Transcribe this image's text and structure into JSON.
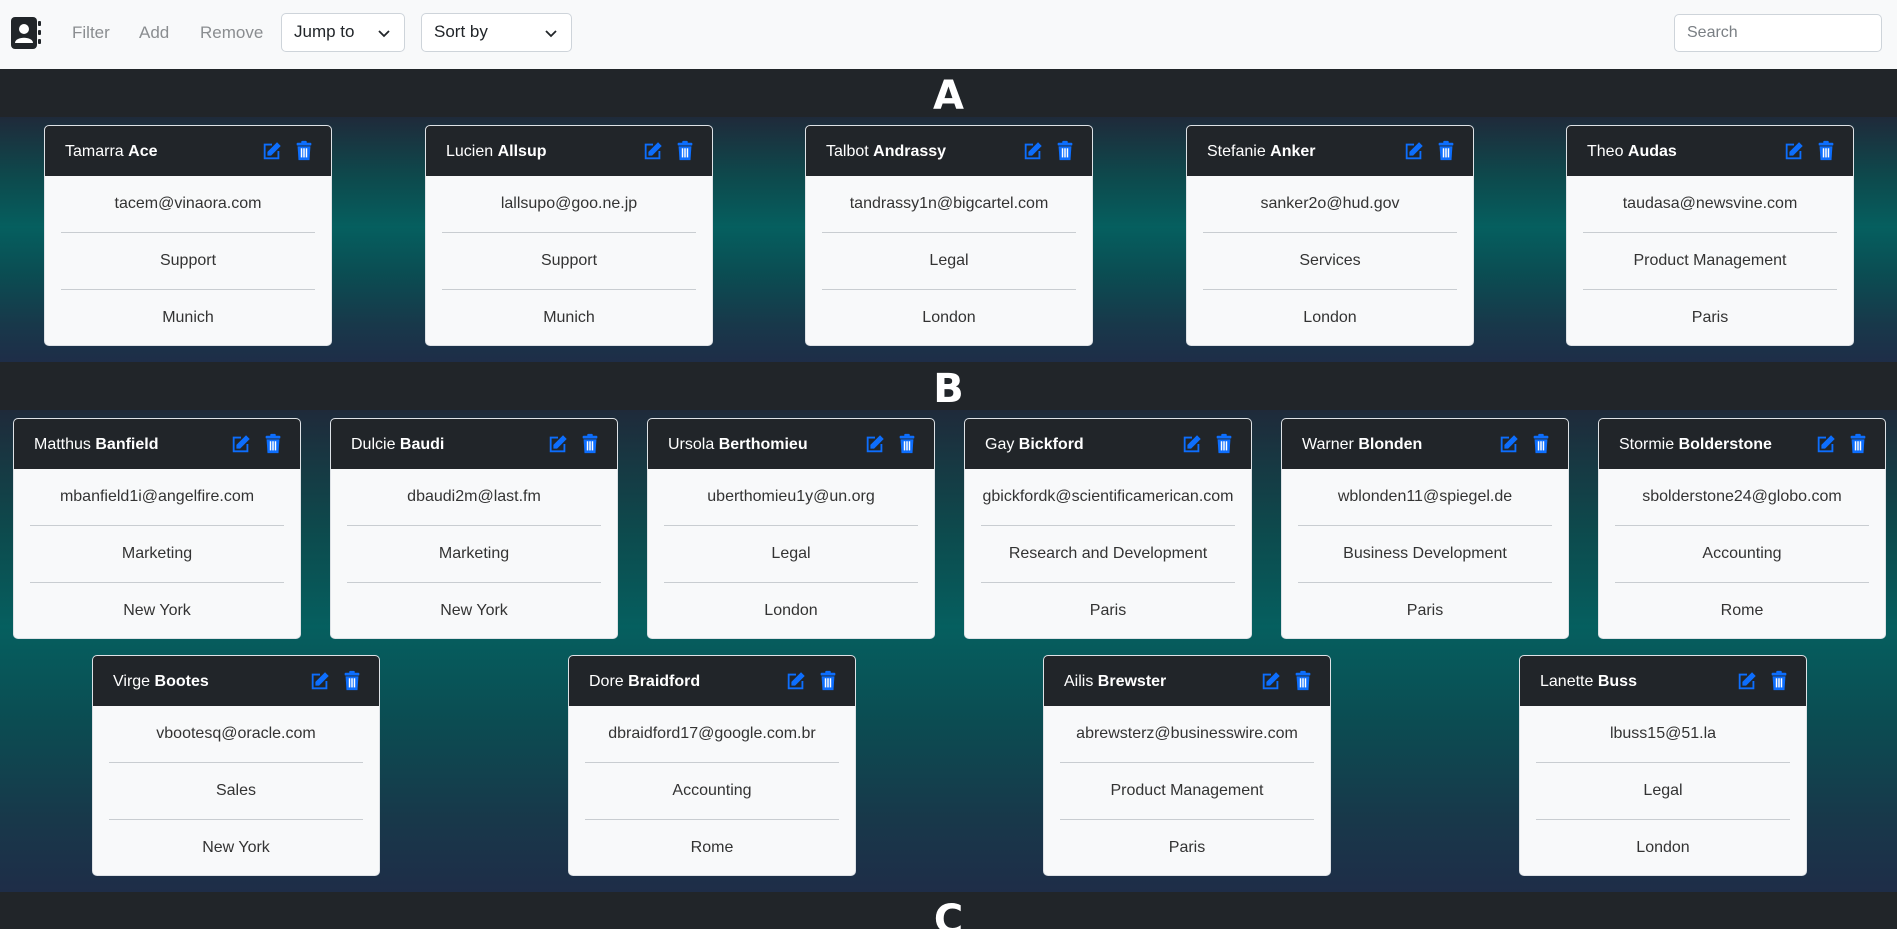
{
  "toolbar": {
    "filter_label": "Filter",
    "add_label": "Add",
    "remove_label": "Remove",
    "jump_label": "Jump to",
    "sort_label": "Sort by",
    "search_placeholder": "Search"
  },
  "sections": [
    {
      "letter": "A",
      "contacts": [
        {
          "first": "Tamarra",
          "last": "Ace",
          "email": "tacem@vinaora.com",
          "department": "Support",
          "city": "Munich"
        },
        {
          "first": "Lucien",
          "last": "Allsup",
          "email": "lallsupo@goo.ne.jp",
          "department": "Support",
          "city": "Munich"
        },
        {
          "first": "Talbot",
          "last": "Andrassy",
          "email": "tandrassy1n@bigcartel.com",
          "department": "Legal",
          "city": "London"
        },
        {
          "first": "Stefanie",
          "last": "Anker",
          "email": "sanker2o@hud.gov",
          "department": "Services",
          "city": "London"
        },
        {
          "first": "Theo",
          "last": "Audas",
          "email": "taudasa@newsvine.com",
          "department": "Product Management",
          "city": "Paris"
        }
      ]
    },
    {
      "letter": "B",
      "contacts": [
        {
          "first": "Matthus",
          "last": "Banfield",
          "email": "mbanfield1i@angelfire.com",
          "department": "Marketing",
          "city": "New York"
        },
        {
          "first": "Dulcie",
          "last": "Baudi",
          "email": "dbaudi2m@last.fm",
          "department": "Marketing",
          "city": "New York"
        },
        {
          "first": "Ursola",
          "last": "Berthomieu",
          "email": "uberthomieu1y@un.org",
          "department": "Legal",
          "city": "London"
        },
        {
          "first": "Gay",
          "last": "Bickford",
          "email": "gbickfordk@scientificamerican.com",
          "department": "Research and Development",
          "city": "Paris"
        },
        {
          "first": "Warner",
          "last": "Blonden",
          "email": "wblonden11@spiegel.de",
          "department": "Business Development",
          "city": "Paris"
        },
        {
          "first": "Stormie",
          "last": "Bolderstone",
          "email": "sbolderstone24@globo.com",
          "department": "Accounting",
          "city": "Rome"
        },
        {
          "first": "Virge",
          "last": "Bootes",
          "email": "vbootesq@oracle.com",
          "department": "Sales",
          "city": "New York"
        },
        {
          "first": "Dore",
          "last": "Braidford",
          "email": "dbraidford17@google.com.br",
          "department": "Accounting",
          "city": "Rome"
        },
        {
          "first": "Ailis",
          "last": "Brewster",
          "email": "abrewsterz@businesswire.com",
          "department": "Product Management",
          "city": "Paris"
        },
        {
          "first": "Lanette",
          "last": "Buss",
          "email": "lbuss15@51.la",
          "department": "Legal",
          "city": "London"
        }
      ]
    },
    {
      "letter": "C",
      "contacts": []
    }
  ],
  "colors": {
    "icon_blue": "#0d6efd",
    "dark": "#212529",
    "teal": "#055f5f"
  }
}
